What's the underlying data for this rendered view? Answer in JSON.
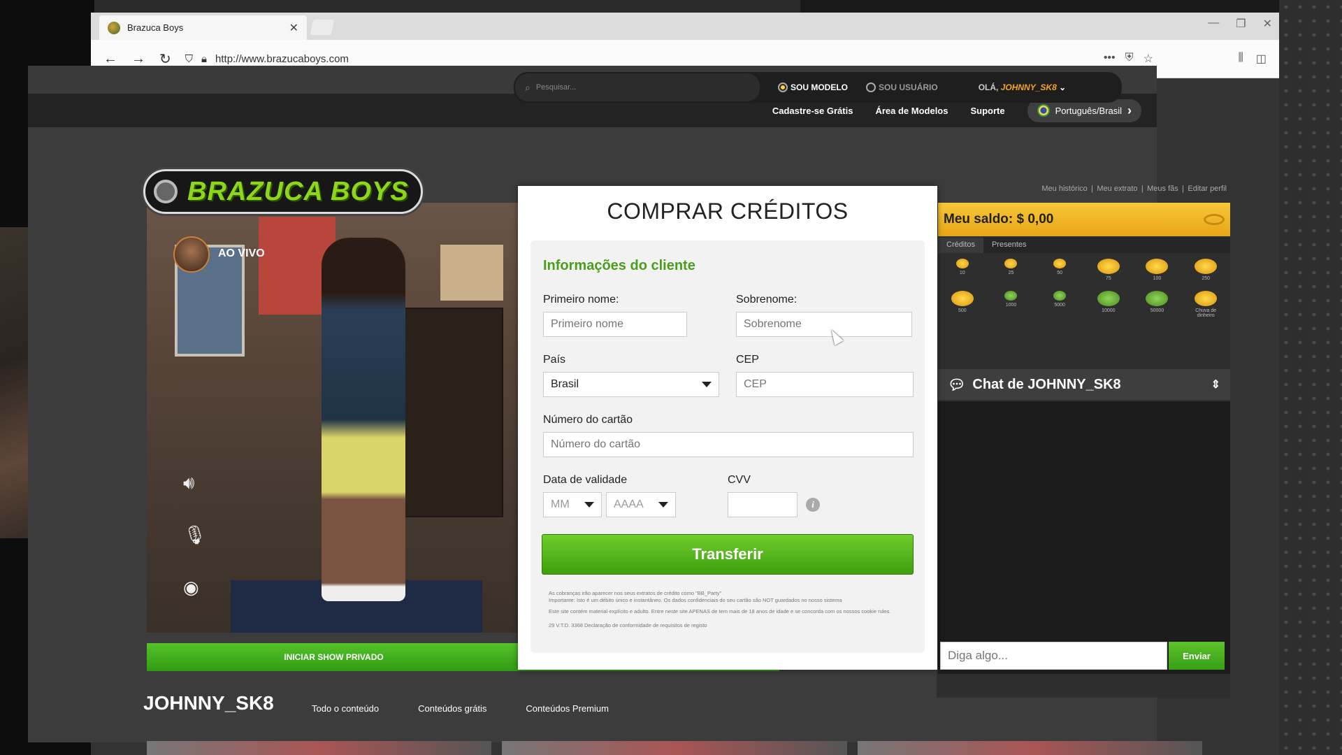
{
  "browser": {
    "tab_title": "Brazuca Boys",
    "url": "http://www.brazucaboys.com"
  },
  "site": {
    "topnav": [
      "Cadastre-se Grátis",
      "Área de Modelos",
      "Suporte"
    ],
    "language": "Português/Brasil",
    "search_placeholder": "Pesquisar...",
    "radio_model": "SOU MODELO",
    "radio_user": "SOU USUÁRIO",
    "hello_prefix": "OLÁ,",
    "username": "JOHNNY_SK8",
    "logo_text": "BRAZUCA BOYS",
    "live_label": "AO VIVO",
    "profile_links": [
      "Meu histórico",
      "|",
      "Meu extrato",
      "|",
      "Meus fãs",
      "|",
      "Editar perfil"
    ],
    "private_show": "INICIAR SHOW PRIVADO",
    "model_name": "JOHNNY_SK8",
    "model_tabs": [
      "Todo o conteúdo",
      "Conteúdos grátis",
      "Conteúdos Premium"
    ]
  },
  "modal": {
    "title": "COMPRAR CRÉDITOS",
    "section_title": "Informações do cliente",
    "first_name_label": "Primeiro nome:",
    "first_name_placeholder": "Primeiro nome",
    "last_name_label": "Sobrenome:",
    "last_name_placeholder": "Sobrenome",
    "country_label": "País",
    "country_value": "Brasil",
    "cep_label": "CEP",
    "cep_placeholder": "CEP",
    "card_label": "Número do cartão",
    "card_placeholder": "Número do cartão",
    "expiry_label": "Data de validade",
    "month_value": "MM",
    "year_value": "AAAA",
    "cvv_label": "CVV",
    "submit": "Transferir",
    "fine_print": [
      "As cobranças irão aparecer nos seus extratos de crédito como \"BB_Party\"",
      "Importante: Isto é um débito único e instantâneo. Os dados confidenciais do seu cartão são NOT guardados no nosso sistema",
      "Este site contém material explícito e adulto. Entre neste site APENAS de tem mais de 18 anos de idade e se concorda com os nossos cookie rules.",
      "29 V.T.D. 3368 Declaração de conformidade de requisitos de registo"
    ]
  },
  "wallet": {
    "balance": "Meu saldo: $ 0,00",
    "tabs": [
      "Créditos",
      "Presentes"
    ],
    "coins": [
      "10",
      "25",
      "50",
      "75",
      "100",
      "250",
      "500",
      "1000",
      "5000",
      "10000",
      "50000",
      "Chuva de dinheiro"
    ]
  },
  "chat": {
    "title": "Chat de JOHNNY_SK8",
    "input_placeholder": "Diga algo...",
    "send": "Enviar"
  }
}
